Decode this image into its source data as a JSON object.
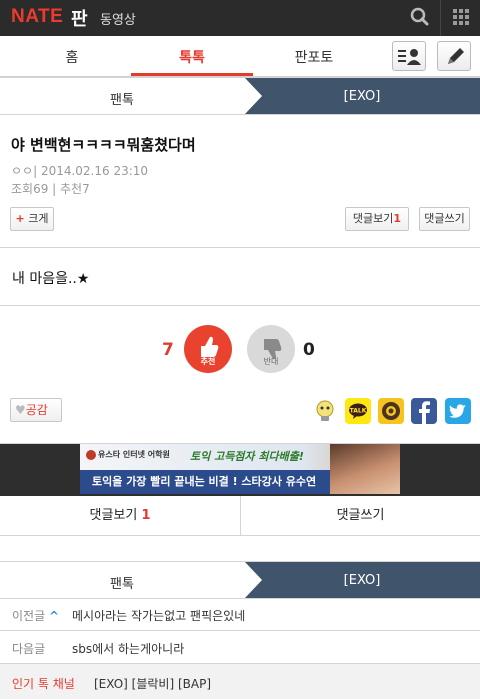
{
  "header": {
    "logo": "NATE",
    "brand": "판",
    "subtitle": "동영상"
  },
  "tabs": {
    "home": "홈",
    "toktok": "톡톡",
    "panphoto": "판포토"
  },
  "breadcrumb": {
    "left": "팬톡",
    "right": "[EXO]"
  },
  "post": {
    "title": "야 변백현ㅋㅋㅋㅋ뭐훔쳤다며",
    "meta": "ㅇㅇ|  2014.02.16 23:10",
    "stats": "조회69 | 추천7",
    "enlarge_icon": "+",
    "enlarge_label": "크게",
    "view_comments_label": "댓글보기",
    "comment_count": "1",
    "write_comment_label": "댓글쓰기",
    "body": "내 마음을..★"
  },
  "vote": {
    "up_count": "7",
    "up_label": "추천",
    "down_label": "반대",
    "down_count": "0"
  },
  "actions": {
    "empathy_heart": "♥",
    "empathy_label": "공감"
  },
  "share_icons": [
    "lightbulb-icon",
    "kakaotalk-icon",
    "kakaostory-icon",
    "facebook-icon",
    "twitter-icon"
  ],
  "ad": {
    "logo": "유스타 인터넷 어학원",
    "slogan": "토익 고득점자 최다배출!",
    "tagline": "토익을 가장 빨리 끝내는 비결 ! 스타강사 유수연"
  },
  "comment_bar": {
    "view_label": "댓글보기",
    "count": "1",
    "write_label": "댓글쓰기"
  },
  "breadcrumb2": {
    "left": "팬톡",
    "right": "[EXO]"
  },
  "nav": {
    "prev_label": "이전글",
    "prev_chevron": "^",
    "prev_title": "메시아라는 작가는없고 팬픽은있네",
    "next_label": "다음글",
    "next_title": "sbs에서 하는게아니라"
  },
  "hot_channels": {
    "label": "인기 톡 채널",
    "links": "[EXO] [블락비] [BAP]"
  },
  "colors": {
    "accent": "#e53b2e",
    "topbar": "#2b2b2b",
    "breadcrumb_dark": "#40556b",
    "ad_blue": "#2c4b8c"
  }
}
